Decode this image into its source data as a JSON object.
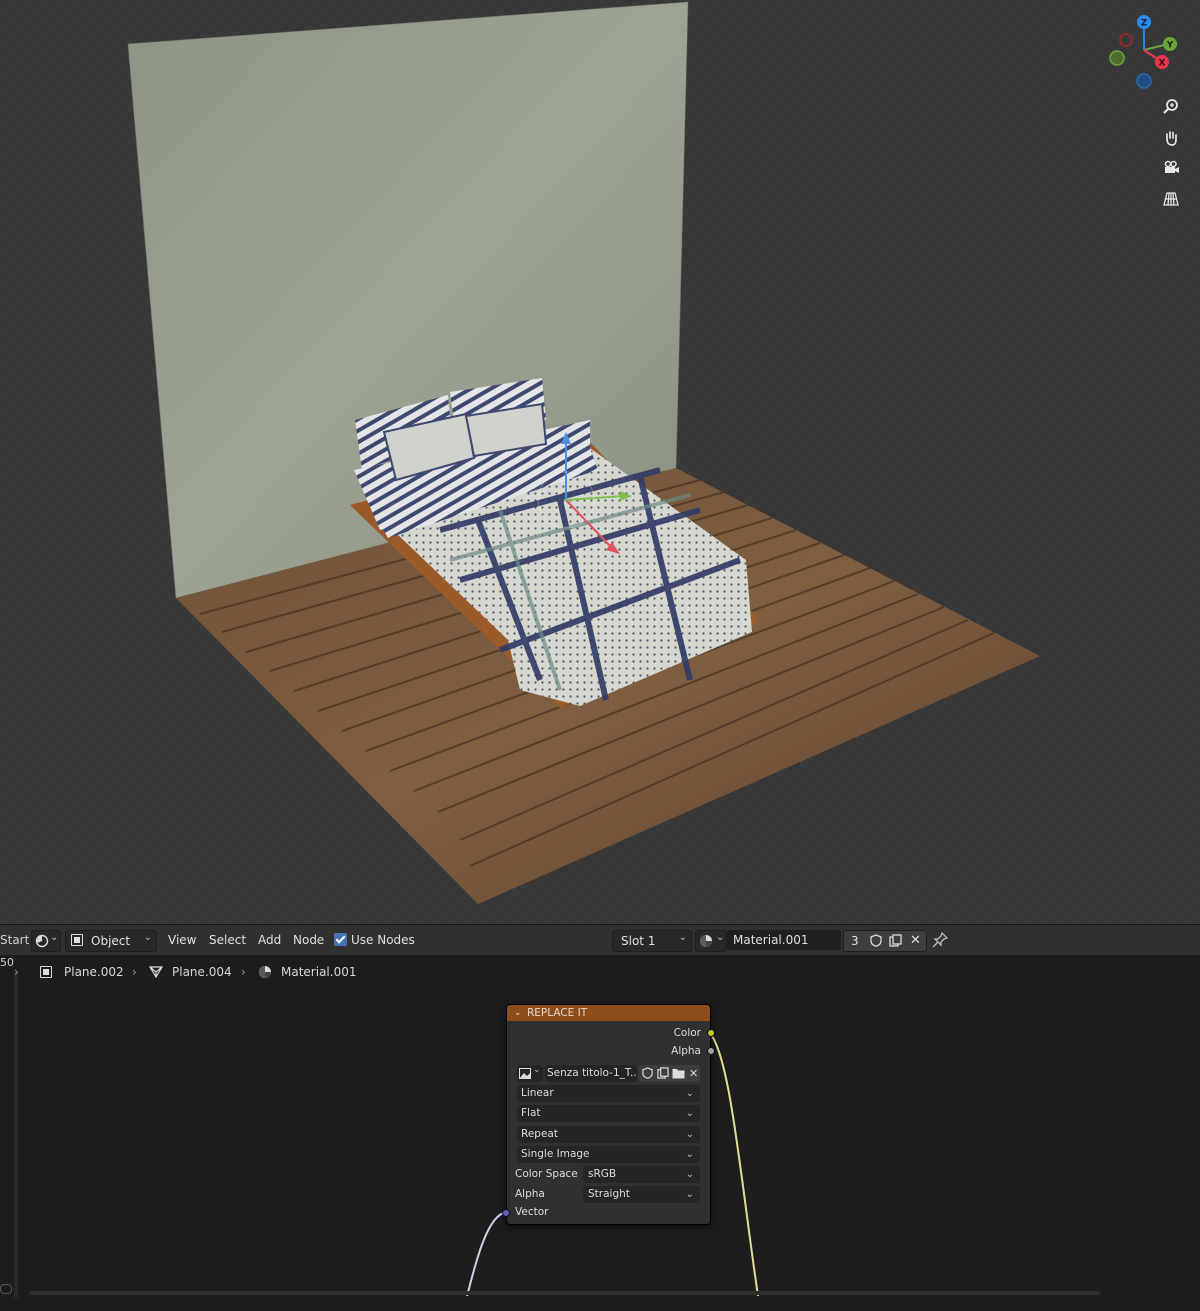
{
  "viewport": {
    "gizmo_axes": [
      "Z",
      "Y",
      "X"
    ],
    "nav_buttons": [
      "zoom-icon",
      "hand-pan-icon",
      "camera-icon",
      "grid-view-icon"
    ]
  },
  "node_header": {
    "left_cut_label": "Start",
    "left_cut_number": "50",
    "mode_label": "Object",
    "menus": [
      "View",
      "Select",
      "Add",
      "Node"
    ],
    "use_nodes_label": "Use Nodes",
    "use_nodes_checked": true,
    "slot_label": "Slot 1",
    "material_name": "Material.001",
    "user_count": "3"
  },
  "breadcrumb": {
    "object": "Plane.002",
    "mesh": "Plane.004",
    "material": "Material.001"
  },
  "image_node": {
    "title": "REPLACE IT",
    "outputs": [
      "Color",
      "Alpha"
    ],
    "image_name": "Senza titolo-1_T...",
    "interpolation": "Linear",
    "projection": "Flat",
    "extension": "Repeat",
    "source": "Single Image",
    "color_space_label": "Color Space",
    "color_space_value": "sRGB",
    "alpha_label": "Alpha",
    "alpha_value": "Straight",
    "input": "Vector"
  },
  "colors": {
    "node_header": "#8c4d1c",
    "socket_color": "#c7c729",
    "socket_vector": "#6363c7",
    "socket_alpha": "#a1a1a1",
    "axis_x": "#e8364f",
    "axis_y": "#6ba539",
    "axis_z": "#2c8ae8",
    "accent": "#4772b3"
  }
}
